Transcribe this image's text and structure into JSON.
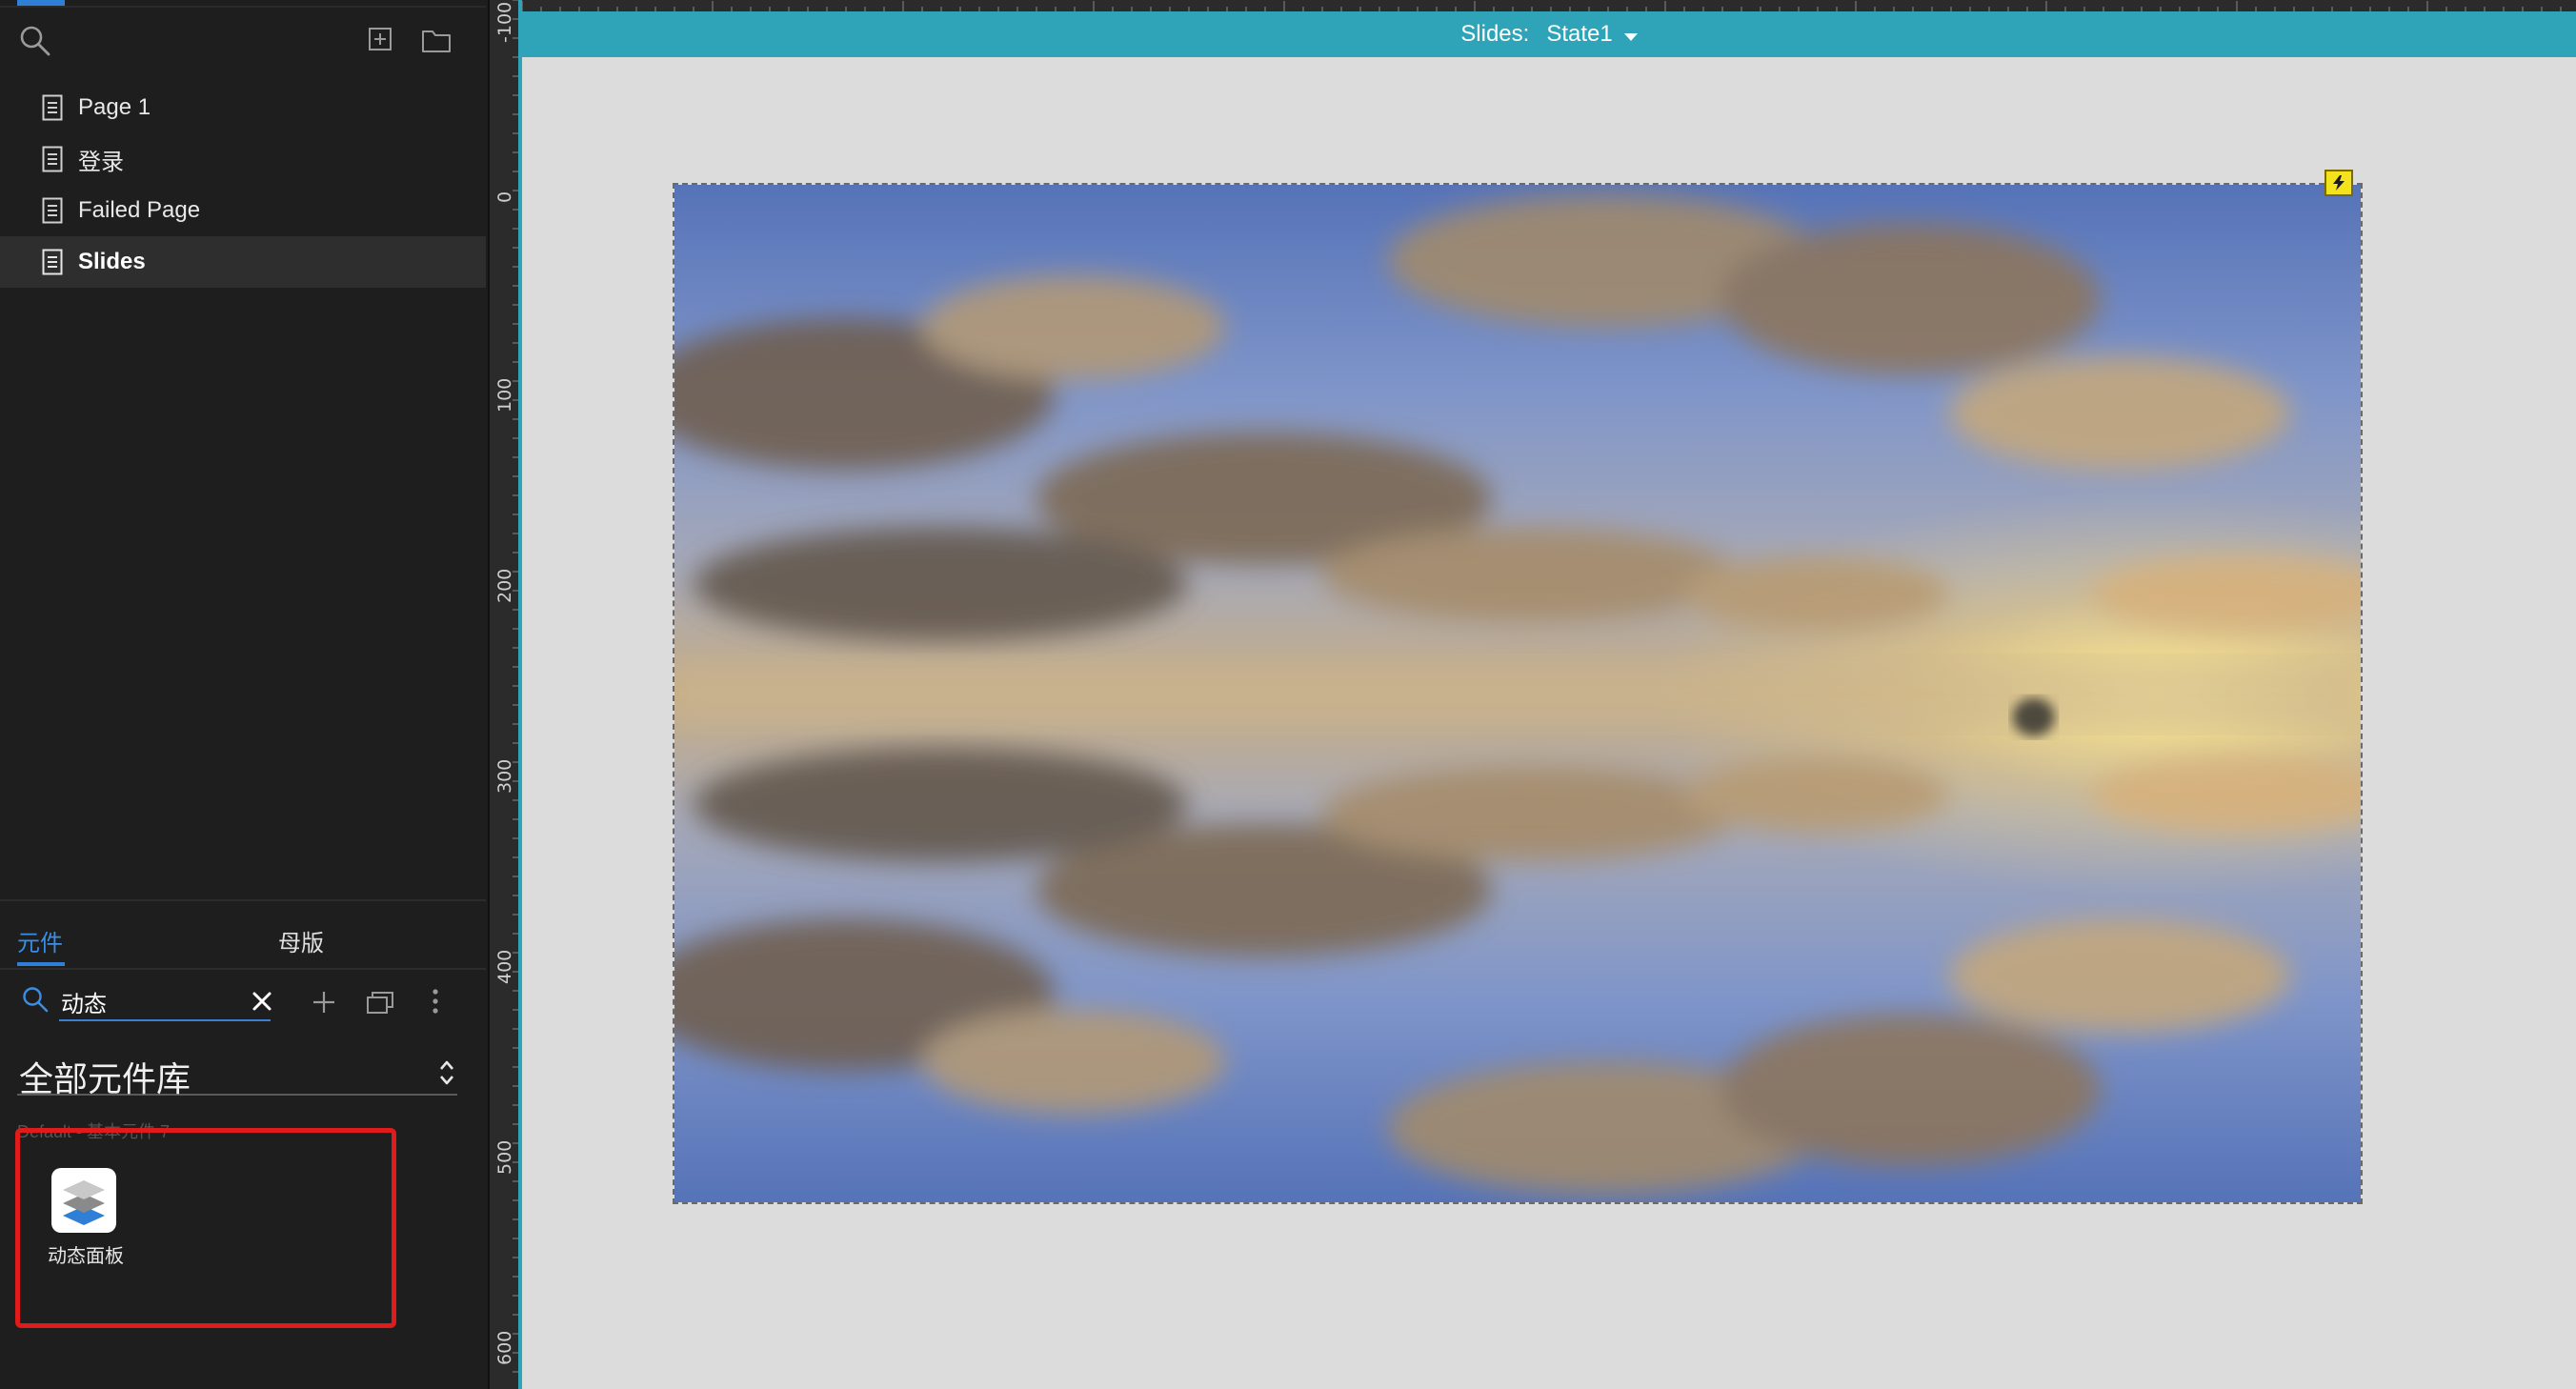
{
  "sidebar": {
    "pages": [
      {
        "label": "Page 1",
        "selected": false
      },
      {
        "label": "登录",
        "selected": false
      },
      {
        "label": "Failed Page",
        "selected": false
      },
      {
        "label": "Slides",
        "selected": true
      }
    ]
  },
  "library": {
    "tabs": [
      {
        "label": "元件",
        "active": true
      },
      {
        "label": "母版",
        "active": false
      }
    ],
    "search": {
      "value": "动态",
      "placeholder": ""
    },
    "selected_library": "全部元件库",
    "group_label": "Default - 基本元件 7",
    "widgets": [
      {
        "label": "动态面板",
        "icon": "dynamic-panel-icon"
      }
    ]
  },
  "canvas": {
    "state_bar": {
      "prefix": "Slides:",
      "state": "State1"
    },
    "ruler": {
      "vertical_labels": [
        "-100",
        "0",
        "100",
        "200",
        "300",
        "400",
        "500",
        "600"
      ]
    },
    "panel_badge": "lightning-icon"
  },
  "colors": {
    "accent_blue": "#2f7fd6",
    "state_bar": "#2fa3b8",
    "highlight": "#e01b1b",
    "canvas_bg": "#dcdcdc",
    "sidebar_bg": "#1e1e1e"
  }
}
